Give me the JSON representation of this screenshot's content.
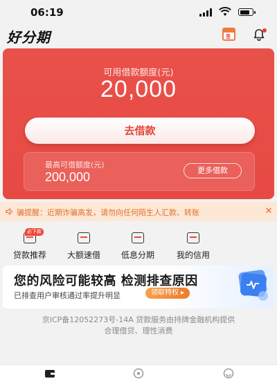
{
  "status_bar": {
    "time": "06:19",
    "battery_level": 0.85
  },
  "header": {
    "app_name": "好分期",
    "calendar_badge": "签",
    "icons": [
      "calendar-icon",
      "bell-icon"
    ]
  },
  "hero": {
    "quota_label": "可用借款额度(元)",
    "quota_value": "20,000",
    "borrow_button": "去借款",
    "max_label": "最高可借额度(元)",
    "max_value": "200,000",
    "more_button": "更多借款"
  },
  "notice": {
    "text": "骗提醒：近期诈骗高发，请勿向任何陌生人汇款、转账",
    "close": "✕"
  },
  "features": [
    {
      "label": "贷款推荐",
      "badge": "必下款",
      "icon": "recommend-icon"
    },
    {
      "label": "大额速借",
      "badge": "",
      "icon": "large-loan-icon"
    },
    {
      "label": "低息分期",
      "badge": "",
      "icon": "installment-icon"
    },
    {
      "label": "我的信用",
      "badge": "",
      "icon": "credit-icon"
    }
  ],
  "risk": {
    "title": "您的风险可能较高 检测排查原因",
    "subtitle": "已排查用户审核通过率提升明显",
    "button": "领取特权 ▸",
    "icon": "shield-icon"
  },
  "footer": {
    "line1": "京ICP备12052273号-14A 贷款服务由持牌金融机构提供",
    "line2": "合理借贷、理性消费"
  },
  "tabs": [
    "wallet-icon",
    "discover-icon",
    "profile-icon"
  ],
  "colors": {
    "primary": "#e74943",
    "notice_bg": "#fde7d6",
    "notice_text": "#e0702a",
    "accent": "#f07a2c"
  }
}
